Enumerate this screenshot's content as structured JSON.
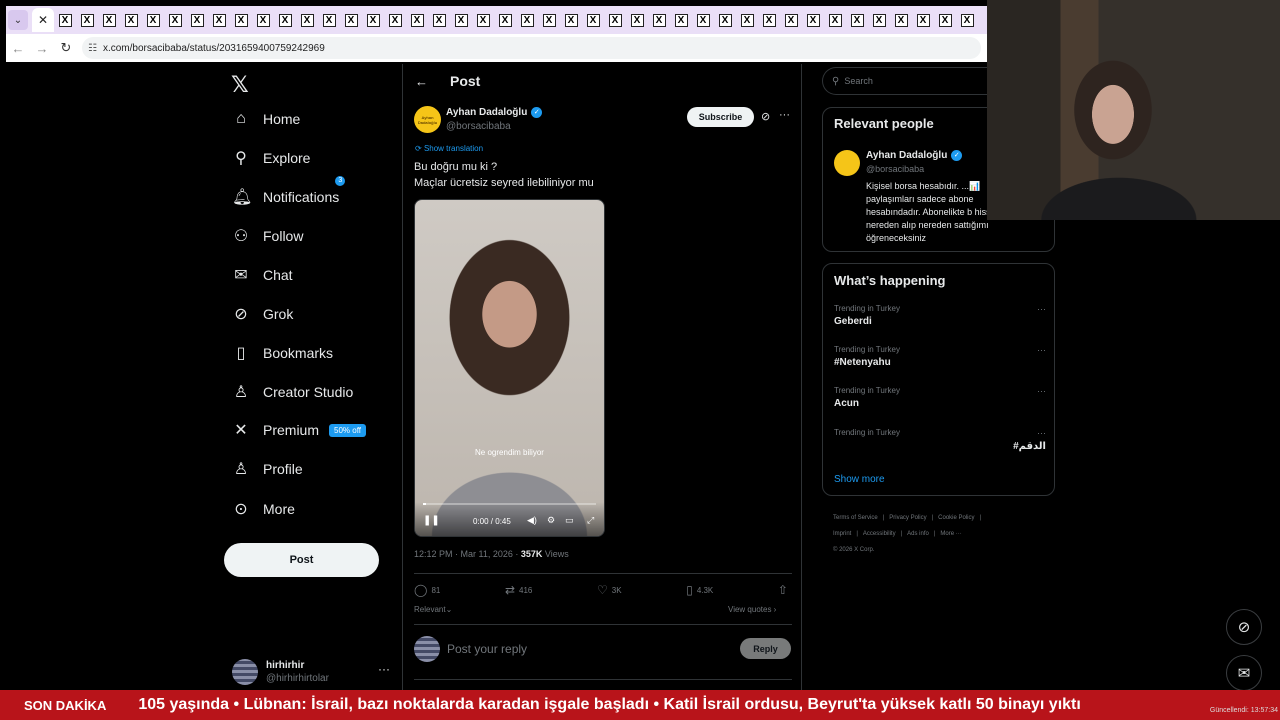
{
  "browser": {
    "url": "x.com/borsacibaba/status/2031659400759242969",
    "tab_count": 42
  },
  "nav": {
    "items": [
      {
        "label": "Home",
        "icon": "home-icon",
        "glyph": "⌂"
      },
      {
        "label": "Explore",
        "icon": "search-icon",
        "glyph": "⚲"
      },
      {
        "label": "Notifications",
        "icon": "bell-icon",
        "glyph": "🔔︎",
        "badge": "3"
      },
      {
        "label": "Follow",
        "icon": "add-person-icon",
        "glyph": "⚇"
      },
      {
        "label": "Chat",
        "icon": "mail-icon",
        "glyph": "✉"
      },
      {
        "label": "Grok",
        "icon": "grok-icon",
        "glyph": "⊘"
      },
      {
        "label": "Bookmarks",
        "icon": "bookmark-icon",
        "glyph": "▯"
      },
      {
        "label": "Creator Studio",
        "icon": "creator-studio-icon",
        "glyph": "♙"
      },
      {
        "label": "Premium",
        "icon": "x-icon",
        "glyph": "✕",
        "pill": "50% off"
      },
      {
        "label": "Profile",
        "icon": "person-icon",
        "glyph": "♙"
      },
      {
        "label": "More",
        "icon": "more-circle-icon",
        "glyph": "⊙"
      }
    ],
    "post_button": "Post",
    "account": {
      "name": "hirhirhir",
      "handle": "@hirhirhirtolar"
    }
  },
  "post": {
    "header_title": "Post",
    "author": {
      "name": "Ayhan Dadaloğlu",
      "handle": "@borsacibaba",
      "avatar_text": "Ayhan Dadaloğlu"
    },
    "subscribe_label": "Subscribe",
    "show_translation": "Show translation",
    "text_line1": "Bu doğru mu ki ?",
    "text_line2": "Maçlar ücretsiz seyred ilebiliniyor mu",
    "video": {
      "subtitle": "Ne ogrendim biliyor",
      "time": "0:00 / 0:45",
      "progress": 0.0
    },
    "timestamp": "12:12 PM · Mar 11, 2026 · ",
    "views_count": "357K",
    "views_label": " Views",
    "stats": {
      "replies": "81",
      "reposts": "416",
      "likes": "3K",
      "bookmarks": "4.3K"
    },
    "relevant_label": "Relevant",
    "view_quotes": "View quotes",
    "reply_placeholder": "Post your reply",
    "reply_button": "Reply"
  },
  "sidebar": {
    "search_placeholder": "Search",
    "relevant_people": {
      "title": "Relevant people",
      "name": "Ayhan Dadaloğlu",
      "handle": "@borsacibaba",
      "bio": "Kişisel borsa hesabıdır. ...📊 paylaşımları sadece abone hesabındadır. Abonelikte b hisseleri nereden alıp nereden sattığımı öğreneceksiniz"
    },
    "whats_happening": {
      "title": "What’s happening",
      "trends": [
        {
          "context": "Trending in Turkey",
          "name": "Geberdi"
        },
        {
          "context": "Trending in Turkey",
          "name": "#Netenyahu"
        },
        {
          "context": "Trending in Turkey",
          "name": "Acun"
        },
        {
          "context": "Trending in Turkey",
          "name": "#الدقم"
        }
      ],
      "show_more": "Show more"
    },
    "footer": {
      "line1": [
        "Terms of Service",
        "|",
        "Privacy Policy",
        "|",
        "Cookie Policy",
        "|"
      ],
      "line2": [
        "Imprint",
        "|",
        "Accessibility",
        "|",
        "Ads info",
        "|",
        "More ···"
      ],
      "copyright": "© 2026 X Corp."
    }
  },
  "ticker": {
    "label": "SON DAKİKA",
    "text": "105 yaşında   •   Lübnan: İsrail, bazı noktalarda karadan işgale başladı   •   Katil İsrail ordusu, Beyrut'ta yüksek katlı 50 binayı yıktı",
    "time": "Güncellendi: 13:57:34"
  },
  "colors": {
    "accent": "#1d9bf0",
    "ticker_bg": "#b8141a",
    "background": "#000000",
    "border": "#2f3336"
  }
}
